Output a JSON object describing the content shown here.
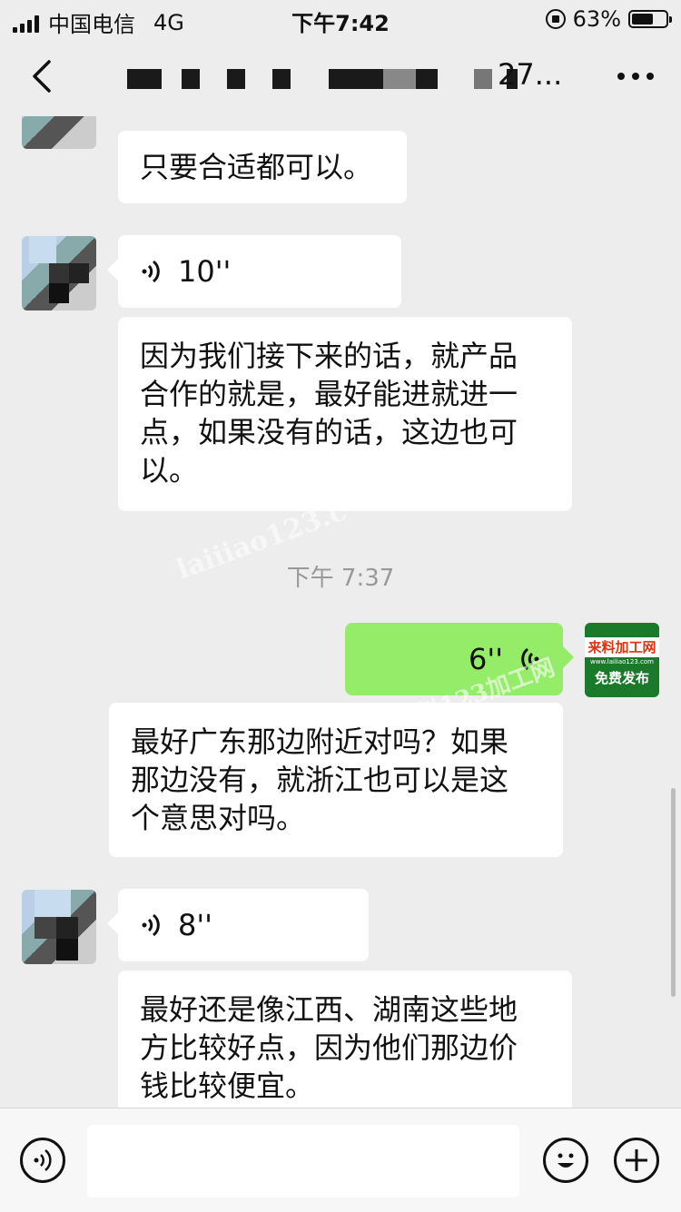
{
  "status_bar": {
    "carrier": "中国电信",
    "network": "4G",
    "time": "下午7:42",
    "battery": "63%",
    "battery_level": 0.63
  },
  "navbar": {
    "title_suffix": "27..."
  },
  "messages": [
    {
      "type": "text",
      "side": "left",
      "text": "只要合适都可以。"
    },
    {
      "type": "voice",
      "side": "left",
      "duration": "10''"
    },
    {
      "type": "text",
      "side": "left",
      "lines": [
        "因为我们接下来的话，就产品",
        "合作的就是，最好能进就进一",
        "点，如果没有的话，这边也可",
        "以。"
      ]
    },
    {
      "type": "timestamp",
      "text": "下午 7:37"
    },
    {
      "type": "voice",
      "side": "right",
      "duration": "6''"
    },
    {
      "type": "text",
      "side": "left",
      "lines": [
        "最好广东那边附近对吗？如果",
        "那边没有，就浙江也可以是这",
        "个意思对吗。"
      ]
    },
    {
      "type": "voice",
      "side": "left",
      "duration": "8''"
    },
    {
      "type": "text",
      "side": "left",
      "lines": [
        "最好还是像江西、湖南这些地",
        "方比较好点，因为他们那边价",
        "钱比较便宜。"
      ]
    }
  ],
  "self_avatar": {
    "line1": "来料加工网",
    "line2": "www.lailiao123.com",
    "line3": "免费发布"
  },
  "watermarks": [
    "laiiiao123.c",
    "义乌来料123加工网"
  ],
  "icons": {
    "back": "chevron-left-icon",
    "more": "more-dots-icon",
    "voice_toggle": "voice-icon",
    "emoji": "emoji-icon",
    "add": "plus-icon"
  }
}
